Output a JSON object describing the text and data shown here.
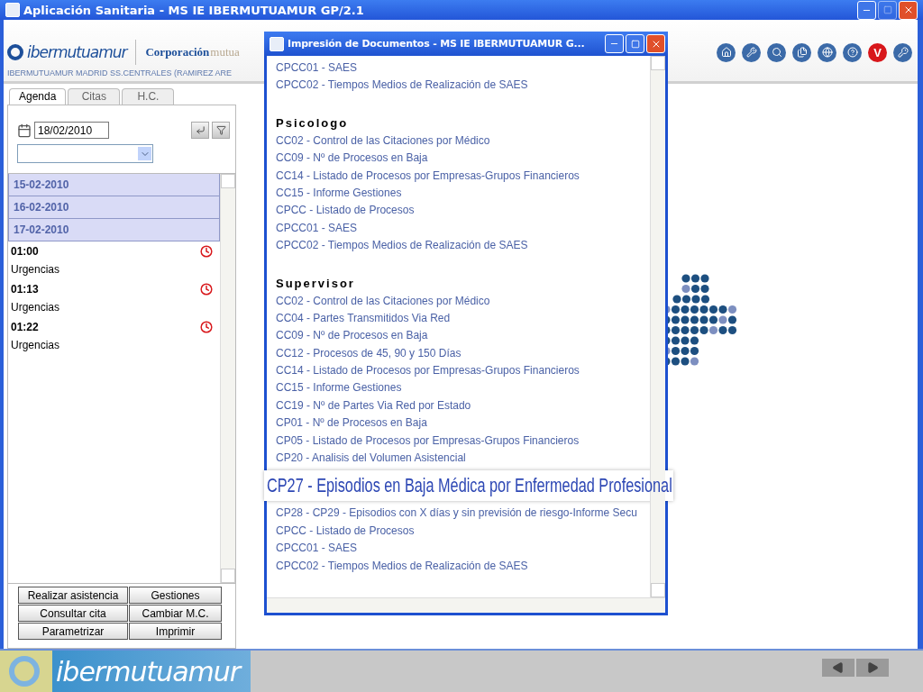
{
  "window": {
    "title": "Aplicación Sanitaria - MS IE IBERMUTUAMUR GP/2.1"
  },
  "header": {
    "logo": "ibermutuamur",
    "partner_name": "Corporación",
    "partner_suffix": "mutua",
    "center": "IBERMUTUAMUR MADRID SS.CENTRALES (RAMIREZ ARE",
    "toolbar_letter": "V"
  },
  "tabs": [
    {
      "label": "Agenda",
      "selected": true
    },
    {
      "label": "Citas",
      "selected": false
    },
    {
      "label": "H.C.",
      "selected": false
    }
  ],
  "agenda": {
    "date": "18/02/2010",
    "days": [
      "15-02-2010",
      "16-02-2010",
      "17-02-2010"
    ],
    "appointments": [
      {
        "time": "01:00",
        "type": "Urgencias"
      },
      {
        "time": "01:13",
        "type": "Urgencias"
      },
      {
        "time": "01:22",
        "type": "Urgencias"
      }
    ]
  },
  "buttons": [
    "Realizar asistencia",
    "Gestiones",
    "Consultar cita",
    "Cambiar M.C.",
    "Parametrizar",
    "Imprimir"
  ],
  "dialog": {
    "title": "Impresión de Documentos - MS IE IBERMUTUAMUR G...",
    "sections": [
      {
        "items": [
          {
            "label": "CPCC01 - SAES",
            "magnified": false
          },
          {
            "label": "CPCC02 - Tiempos Medios de Realización de SAES",
            "magnified": false
          }
        ]
      },
      {
        "heading": "Psicologo",
        "items": [
          {
            "label": "CC02 - Control de las Citaciones por Médico",
            "magnified": false
          },
          {
            "label": "CC09 - Nº de Procesos en Baja",
            "magnified": false
          },
          {
            "label": "CC14 - Listado de Procesos por Empresas-Grupos Financieros",
            "magnified": false
          },
          {
            "label": "CC15 - Informe Gestiones",
            "magnified": false
          },
          {
            "label": "CPCC - Listado de Procesos",
            "magnified": false
          },
          {
            "label": "CPCC01 - SAES",
            "magnified": false
          },
          {
            "label": "CPCC02 - Tiempos Medios de Realización de SAES",
            "magnified": false
          }
        ]
      },
      {
        "heading": "Supervisor",
        "items": [
          {
            "label": "CC02 - Control de las Citaciones por Médico",
            "magnified": false
          },
          {
            "label": "CC04 - Partes Transmitidos Via Red",
            "magnified": false
          },
          {
            "label": "CC09 - Nº de Procesos en Baja",
            "magnified": false
          },
          {
            "label": "CC12 - Procesos de 45, 90 y 150 Días",
            "magnified": false
          },
          {
            "label": "CC14 - Listado de Procesos por Empresas-Grupos Financieros",
            "magnified": false
          },
          {
            "label": "CC15 - Informe Gestiones",
            "magnified": false
          },
          {
            "label": "CC19 - Nº de Partes Via Red por Estado",
            "magnified": false
          },
          {
            "label": "CP01 - Nº de Procesos en Baja",
            "magnified": false
          },
          {
            "label": "CP05 - Listado de Procesos por Empresas-Grupos Financieros",
            "magnified": false
          },
          {
            "label": "CP20 - Analisis del Volumen Asistencial",
            "magnified": false
          },
          {
            "label": "CP27 - Episodios en Baja Médica por Enfermedad Profesional",
            "magnified": true
          },
          {
            "label": "CP28 - CP29 - Episodios con X días y sin previsión de riesgo-Informe Secu",
            "magnified": false
          },
          {
            "label": "CPCC - Listado de Procesos",
            "magnified": false
          },
          {
            "label": "CPCC01 - SAES",
            "magnified": false
          },
          {
            "label": "CPCC02 - Tiempos Medios de Realización de SAES",
            "magnified": false
          }
        ]
      }
    ]
  },
  "footer": {
    "logo": "ibermutuamur"
  }
}
